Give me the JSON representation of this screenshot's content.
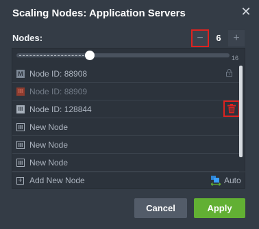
{
  "dialog": {
    "title": "Scaling Nodes: Application Servers",
    "close_icon": "close-icon"
  },
  "nodes": {
    "label": "Nodes:",
    "count": "6",
    "minus": "−",
    "plus": "+"
  },
  "slider": {
    "max_label": "16",
    "value": 6,
    "max": 16
  },
  "list": [
    {
      "id": "node-88908",
      "icon": "master-node-icon",
      "glyph": "M",
      "label": "Node ID: 88908",
      "dim": false,
      "locked": true
    },
    {
      "id": "node-88909",
      "icon": "node-removing-icon",
      "glyph": "III",
      "label": "Node ID: 88909",
      "dim": true
    },
    {
      "id": "node-128844",
      "icon": "node-icon",
      "glyph": "III",
      "label": "Node ID: 128844",
      "dim": false,
      "deletable": true
    },
    {
      "id": "new-1",
      "icon": "new-node-icon",
      "glyph": "III",
      "label": "New Node",
      "dim": false
    },
    {
      "id": "new-2",
      "icon": "new-node-icon",
      "glyph": "III",
      "label": "New Node",
      "dim": false
    },
    {
      "id": "new-3",
      "icon": "new-node-icon",
      "glyph": "III",
      "label": "New Node",
      "dim": false
    }
  ],
  "footer": {
    "add_label": "Add New Node",
    "add_glyph": "+",
    "auto_label": "Auto"
  },
  "buttons": {
    "cancel": "Cancel",
    "apply": "Apply"
  },
  "colors": {
    "background": "#343c46",
    "highlight": "#e0221f",
    "apply": "#62b033",
    "cancel": "#535c69"
  }
}
